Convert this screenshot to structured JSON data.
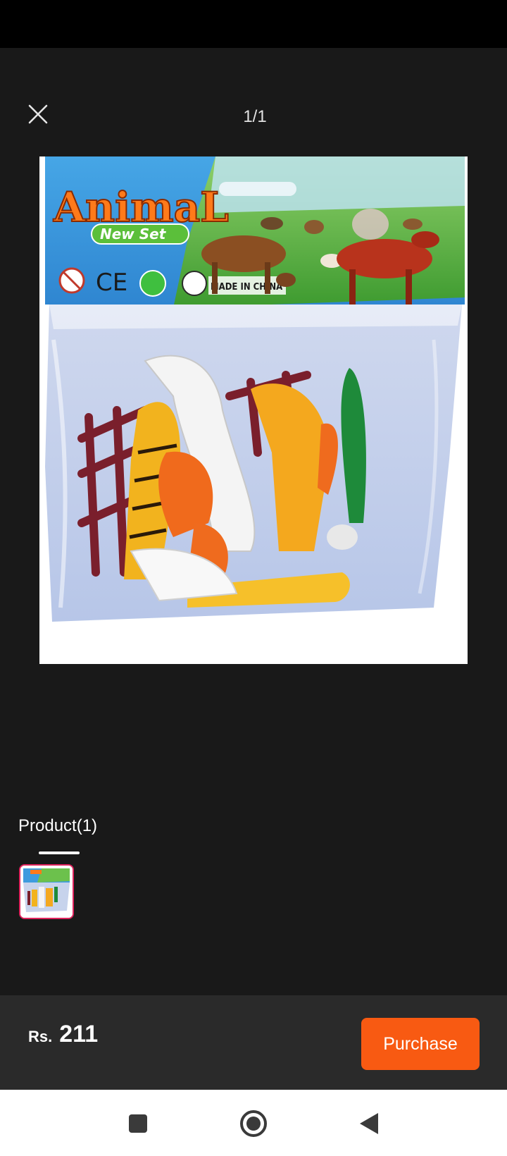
{
  "viewer": {
    "page_counter": "1/1",
    "close_icon": "close-icon"
  },
  "product_image": {
    "brand_text": "AnimaL",
    "subtitle_text": "New Set",
    "made_in_text": "MADE IN CHINA",
    "ce_mark": "CE"
  },
  "product_tab": {
    "label": "Product(1)"
  },
  "bottom_bar": {
    "currency": "Rs.",
    "price": "211",
    "purchase_label": "Purchase"
  },
  "colors": {
    "background": "#191919",
    "bottom_bar": "#2a2a2a",
    "accent": "#f85a12",
    "thumb_border": "#e0245e"
  },
  "nav": {
    "recents_icon": "square-recents-icon",
    "home_icon": "circle-home-icon",
    "back_icon": "triangle-back-icon"
  }
}
